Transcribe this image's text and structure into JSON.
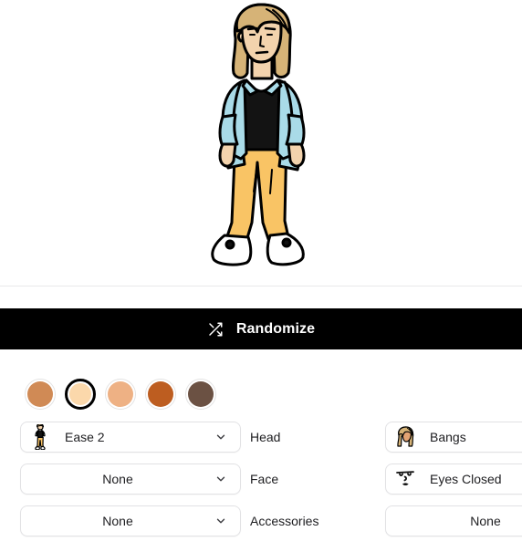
{
  "preview": {
    "name": "character-preview",
    "character": {
      "hair_color": "#d6b377",
      "skin_color": "#f3d3ad",
      "shirt_color": "#a9dbe8",
      "top_color": "#131313",
      "pants_color": "#f9c465",
      "shoe_color": "#ffffff",
      "outline_color": "#000000"
    }
  },
  "randomize": {
    "label": "Randomize",
    "icon": "shuffle-icon",
    "background": "#000000",
    "text_color": "#ffffff"
  },
  "skin_tones": {
    "selected_index": 1,
    "swatches": [
      {
        "name": "skin-tone-1",
        "color": "#d08a55"
      },
      {
        "name": "skin-tone-2",
        "color": "#fbd8ab"
      },
      {
        "name": "skin-tone-3",
        "color": "#eeb184"
      },
      {
        "name": "skin-tone-4",
        "color": "#bd5d20"
      },
      {
        "name": "skin-tone-5",
        "color": "#6b5143"
      }
    ]
  },
  "controls": {
    "rows": [
      {
        "left": {
          "value": "Ease 2",
          "icon": "body-thumbnail-icon",
          "has_chevron": true,
          "centered": false
        },
        "label": "Head",
        "right": {
          "value": "Bangs",
          "icon": "hair-thumbnail-icon",
          "has_chevron": false,
          "centered": false
        }
      },
      {
        "left": {
          "value": "None",
          "icon": "",
          "has_chevron": true,
          "centered": true
        },
        "label": "Face",
        "right": {
          "value": "Eyes Closed",
          "icon": "face-thumbnail-icon",
          "has_chevron": false,
          "centered": false
        }
      },
      {
        "left": {
          "value": "None",
          "icon": "",
          "has_chevron": true,
          "centered": true
        },
        "label": "Accessories",
        "right": {
          "value": "None",
          "icon": "",
          "has_chevron": false,
          "centered": true
        }
      }
    ]
  },
  "theme": {
    "page_background": "#ffffff",
    "divider": "#e9e9ea",
    "border": "#e2e2e4",
    "text": "#1d1d20"
  }
}
